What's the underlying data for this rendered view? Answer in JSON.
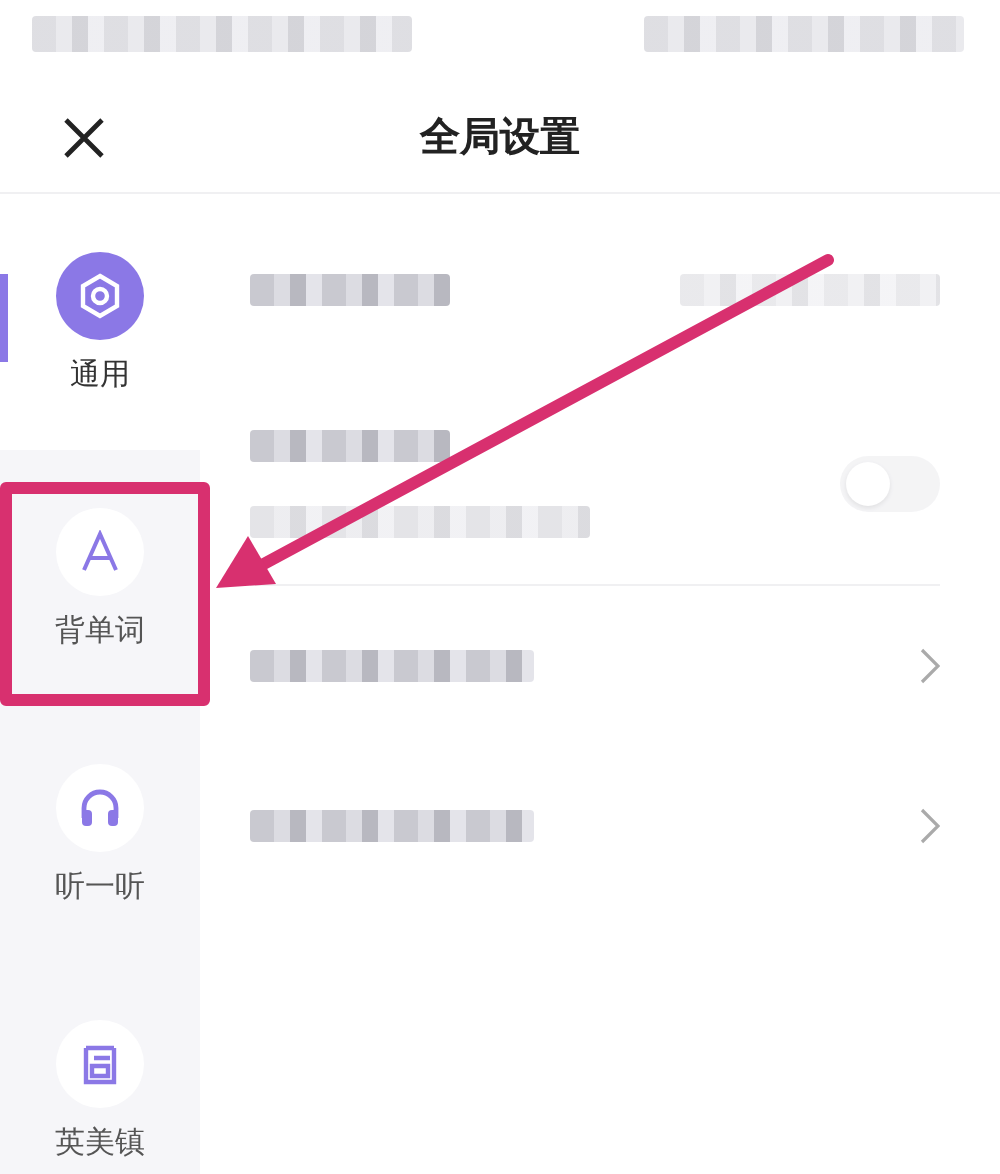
{
  "header": {
    "title": "全局设置"
  },
  "sidebar": {
    "items": [
      {
        "label": "通用",
        "selected": true,
        "highlighted": false
      },
      {
        "label": "背单词",
        "selected": false,
        "highlighted": true
      },
      {
        "label": "听一听",
        "selected": false,
        "highlighted": false
      },
      {
        "label": "英美镇",
        "selected": false,
        "highlighted": false
      }
    ]
  },
  "settings": {
    "rows": [
      {
        "kind": "value"
      },
      {
        "kind": "toggle",
        "on": false
      },
      {
        "kind": "link"
      },
      {
        "kind": "link"
      }
    ]
  }
}
